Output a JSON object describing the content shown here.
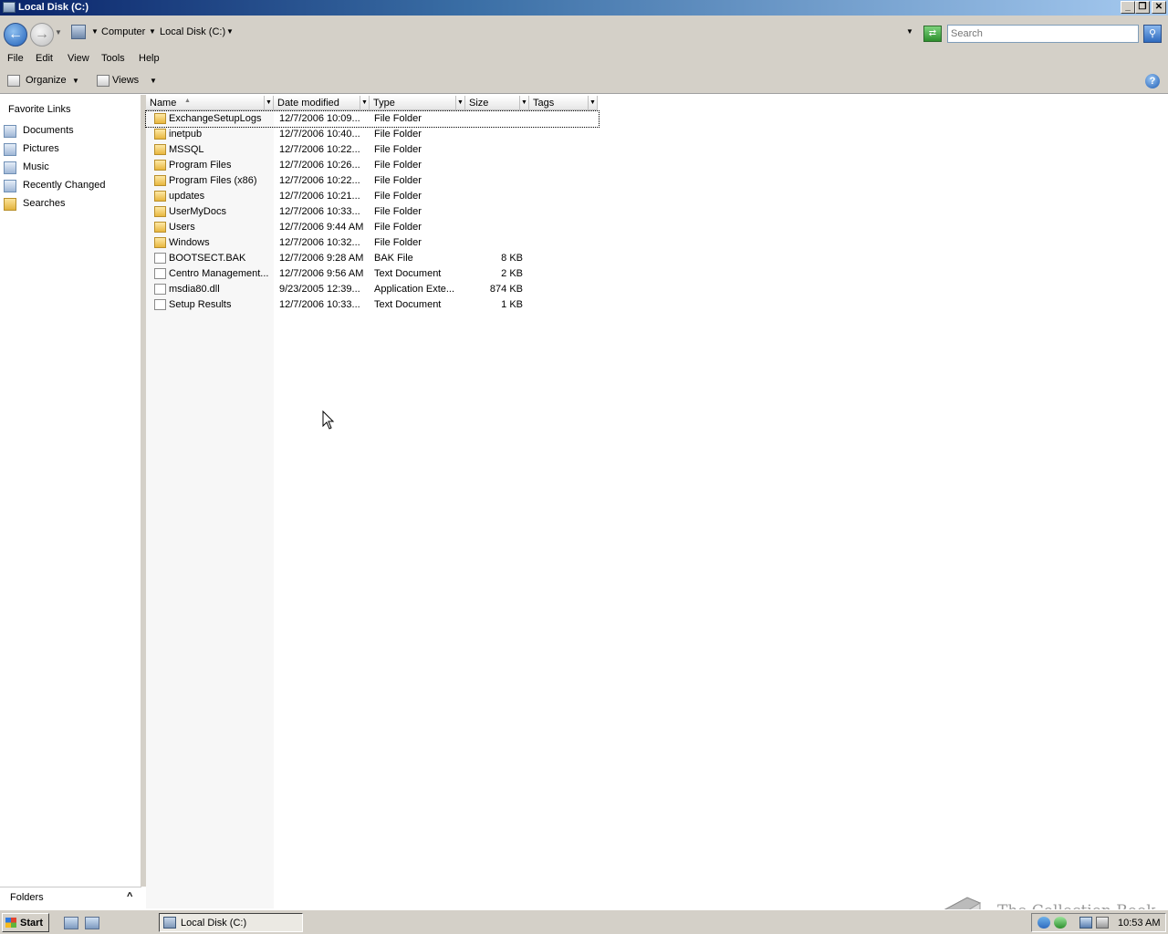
{
  "window": {
    "title": "Local Disk (C:)"
  },
  "address": {
    "crumbs": [
      "Computer",
      "Local Disk (C:)"
    ],
    "search_placeholder": "Search"
  },
  "menu": [
    "File",
    "Edit",
    "View",
    "Tools",
    "Help"
  ],
  "toolbar": {
    "organize": "Organize",
    "views": "Views"
  },
  "nav": {
    "heading": "Favorite Links",
    "links": [
      "Documents",
      "Pictures",
      "Music",
      "Recently Changed",
      "Searches"
    ],
    "folders_label": "Folders"
  },
  "columns": [
    "Name",
    "Date modified",
    "Type",
    "Size",
    "Tags"
  ],
  "files": [
    {
      "name": "ExchangeSetupLogs",
      "date": "12/7/2006 10:09...",
      "type": "File Folder",
      "size": "",
      "icon": "folder-icon"
    },
    {
      "name": "inetpub",
      "date": "12/7/2006 10:40...",
      "type": "File Folder",
      "size": "",
      "icon": "folder-icon"
    },
    {
      "name": "MSSQL",
      "date": "12/7/2006 10:22...",
      "type": "File Folder",
      "size": "",
      "icon": "folder-icon"
    },
    {
      "name": "Program Files",
      "date": "12/7/2006 10:26...",
      "type": "File Folder",
      "size": "",
      "icon": "folder-icon"
    },
    {
      "name": "Program Files (x86)",
      "date": "12/7/2006 10:22...",
      "type": "File Folder",
      "size": "",
      "icon": "folder-icon"
    },
    {
      "name": "updates",
      "date": "12/7/2006 10:21...",
      "type": "File Folder",
      "size": "",
      "icon": "folder-icon"
    },
    {
      "name": "UserMyDocs",
      "date": "12/7/2006 10:33...",
      "type": "File Folder",
      "size": "",
      "icon": "special-folder-icon"
    },
    {
      "name": "Users",
      "date": "12/7/2006 9:44 AM",
      "type": "File Folder",
      "size": "",
      "icon": "folder-icon"
    },
    {
      "name": "Windows",
      "date": "12/7/2006 10:32...",
      "type": "File Folder",
      "size": "",
      "icon": "folder-icon"
    },
    {
      "name": "BOOTSECT.BAK",
      "date": "12/7/2006 9:28 AM",
      "type": "BAK File",
      "size": "8 KB",
      "icon": "file-icon"
    },
    {
      "name": "Centro Management...",
      "date": "12/7/2006 9:56 AM",
      "type": "Text Document",
      "size": "2 KB",
      "icon": "text-file-icon"
    },
    {
      "name": "msdia80.dll",
      "date": "9/23/2005 12:39...",
      "type": "Application Exte...",
      "size": "874 KB",
      "icon": "dll-file-icon"
    },
    {
      "name": "Setup Results",
      "date": "12/7/2006 10:33...",
      "type": "Text Document",
      "size": "1 KB",
      "icon": "text-file-icon"
    }
  ],
  "taskbar": {
    "start": "Start",
    "task": "Local Disk (C:)",
    "clock": "10:53 AM"
  },
  "watermark": "The Collection Book"
}
